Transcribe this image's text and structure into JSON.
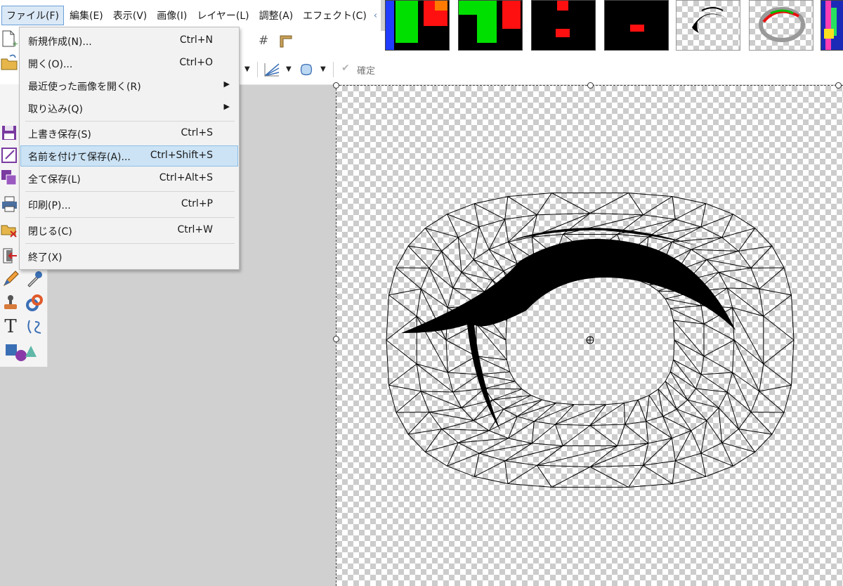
{
  "menubar": {
    "items": [
      "ファイル(F)",
      "編集(E)",
      "表示(V)",
      "画像(I)",
      "レイヤー(L)",
      "調整(A)",
      "エフェクト(C)"
    ],
    "overflow_icon": "chevron-left-icon"
  },
  "toolbar": {
    "confirm_label": "確定",
    "icons": [
      "grid-icon",
      "ruler-icon",
      "line-style-icon",
      "selection-mode-icon",
      "checkmark-icon"
    ]
  },
  "file_menu": {
    "items": [
      {
        "label": "新規作成(N)...",
        "shortcut": "Ctrl+N",
        "icon": "new-file-icon"
      },
      {
        "label": "開く(O)...",
        "shortcut": "Ctrl+O",
        "icon": "open-folder-icon"
      },
      {
        "label": "最近使った画像を開く(R)",
        "shortcut": "",
        "icon": "",
        "submenu": true
      },
      {
        "label": "取り込み(Q)",
        "shortcut": "",
        "icon": "",
        "submenu": true
      },
      {
        "label": "上書き保存(S)",
        "shortcut": "Ctrl+S",
        "icon": "save-icon"
      },
      {
        "label": "名前を付けて保存(A)...",
        "shortcut": "Ctrl+Shift+S",
        "icon": "save-as-icon",
        "highlighted": true
      },
      {
        "label": "全て保存(L)",
        "shortcut": "Ctrl+Alt+S",
        "icon": "save-all-icon"
      },
      {
        "label": "印刷(P)...",
        "shortcut": "Ctrl+P",
        "icon": "print-icon"
      },
      {
        "label": "閉じる(C)",
        "shortcut": "Ctrl+W",
        "icon": "close-folder-icon"
      },
      {
        "label": "終了(X)",
        "shortcut": "",
        "icon": "exit-icon"
      }
    ],
    "submenu_arrow": "▶"
  },
  "tools": [
    "pencil-icon",
    "color-picker-icon",
    "clone-stamp-icon",
    "recolor-icon",
    "text-icon",
    "line-curve-icon",
    "shapes-icon"
  ],
  "tool_glyphs": {
    "text": "T"
  },
  "colors": {
    "menu_highlight": "#cce3f5",
    "active_menu": "#dbe9f7",
    "workspace": "#d0d0d0"
  }
}
